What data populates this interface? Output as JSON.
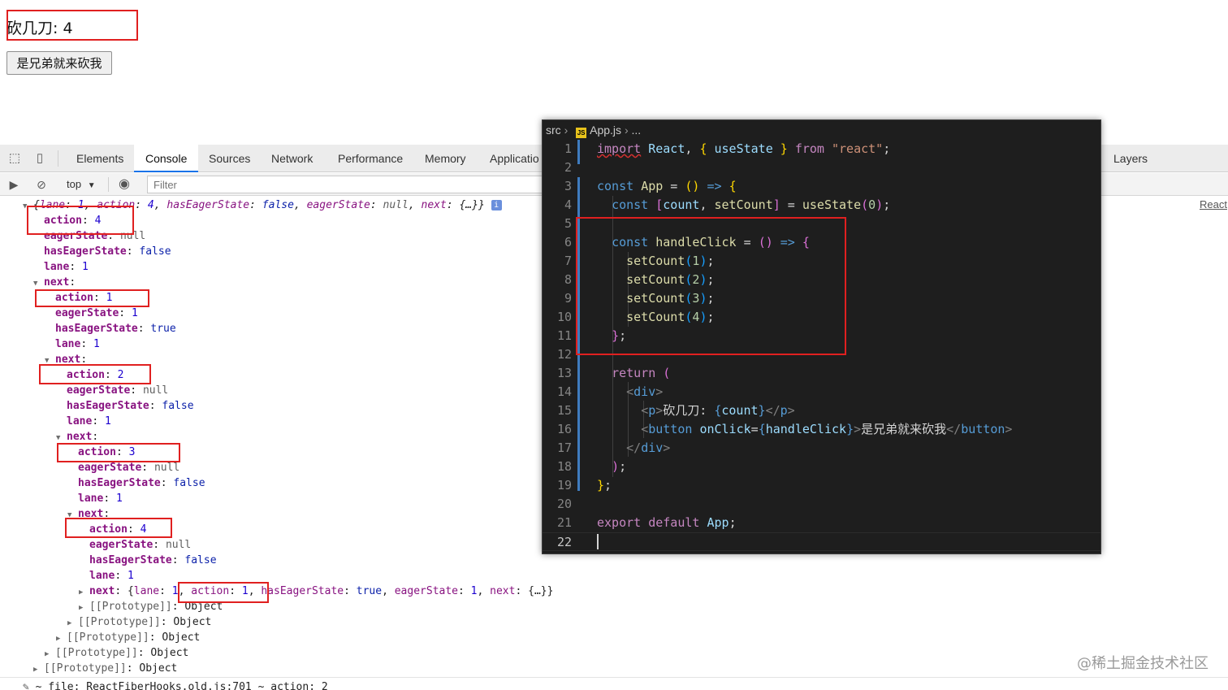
{
  "page": {
    "counter_label": "砍几刀: 4",
    "button_label": "是兄弟就来砍我"
  },
  "devtools": {
    "tabs": [
      {
        "label": "Elements"
      },
      {
        "label": "Console"
      },
      {
        "label": "Sources"
      },
      {
        "label": "Network"
      },
      {
        "label": "Performance"
      },
      {
        "label": "Memory"
      },
      {
        "label": "Applicatio"
      },
      {
        "label": "Layers"
      }
    ],
    "active_tab": "Console",
    "context": "top",
    "filter_placeholder": "Filter",
    "source_link": "React"
  },
  "console": {
    "summary": {
      "open": "{",
      "lane_key": "lane",
      "lane": "1",
      "action_key": "action",
      "action": "4",
      "eager_key": "hasEagerState",
      "eager": "false",
      "state_key": "eagerState",
      "state": "null",
      "next_key": "next",
      "next": "{…}}"
    },
    "levels": [
      {
        "action": "4",
        "eagerState": "null",
        "hasEagerState": "false",
        "lane": "1"
      },
      {
        "action": "1",
        "eagerState": "1",
        "hasEagerState": "true",
        "lane": "1"
      },
      {
        "action": "2",
        "eagerState": "null",
        "hasEagerState": "false",
        "lane": "1"
      },
      {
        "action": "3",
        "eagerState": "null",
        "hasEagerState": "false",
        "lane": "1"
      },
      {
        "action": "4",
        "eagerState": "null",
        "hasEagerState": "false",
        "lane": "1"
      }
    ],
    "collapsed_next": {
      "lane": "1",
      "action": "1",
      "hasEagerState": "true",
      "eagerState": "1",
      "tail": "{…}}"
    },
    "prototype_label": "[[Prototype]]",
    "prototype_value": "Object",
    "bottom_line": "~ file: ReactFiberHooks.old.js:701 ~ action: 2"
  },
  "editor": {
    "breadcrumb": {
      "folder": "src",
      "file": "App.js",
      "more": "..."
    },
    "line_numbers": [
      "1",
      "2",
      "3",
      "4",
      "5",
      "6",
      "7",
      "8",
      "9",
      "10",
      "11",
      "12",
      "13",
      "14",
      "15",
      "16",
      "17",
      "18",
      "19",
      "20",
      "21",
      "22"
    ],
    "code": {
      "import_kw": "import",
      "react_id": "React",
      "use_state": "useState",
      "from_kw": "from",
      "react_str": "\"react\"",
      "const_kw": "const",
      "app_id": "App",
      "count_id": "count",
      "set_count": "setCount",
      "zero": "0",
      "handle_click": "handleClick",
      "calls": [
        "1",
        "2",
        "3",
        "4"
      ],
      "return_kw": "return",
      "div_tag": "div",
      "p_tag": "p",
      "p_text": "砍几刀: ",
      "button_tag": "button",
      "onclick_attr": "onClick",
      "button_text": "是兄弟就来砍我",
      "export_kw": "export",
      "default_kw": "default"
    }
  },
  "watermark": "@稀土掘金技术社区",
  "colors": {
    "highlight_box": "#e02020",
    "editor_bg": "#1e1e1e",
    "devtools_active": "#1a73e8"
  }
}
